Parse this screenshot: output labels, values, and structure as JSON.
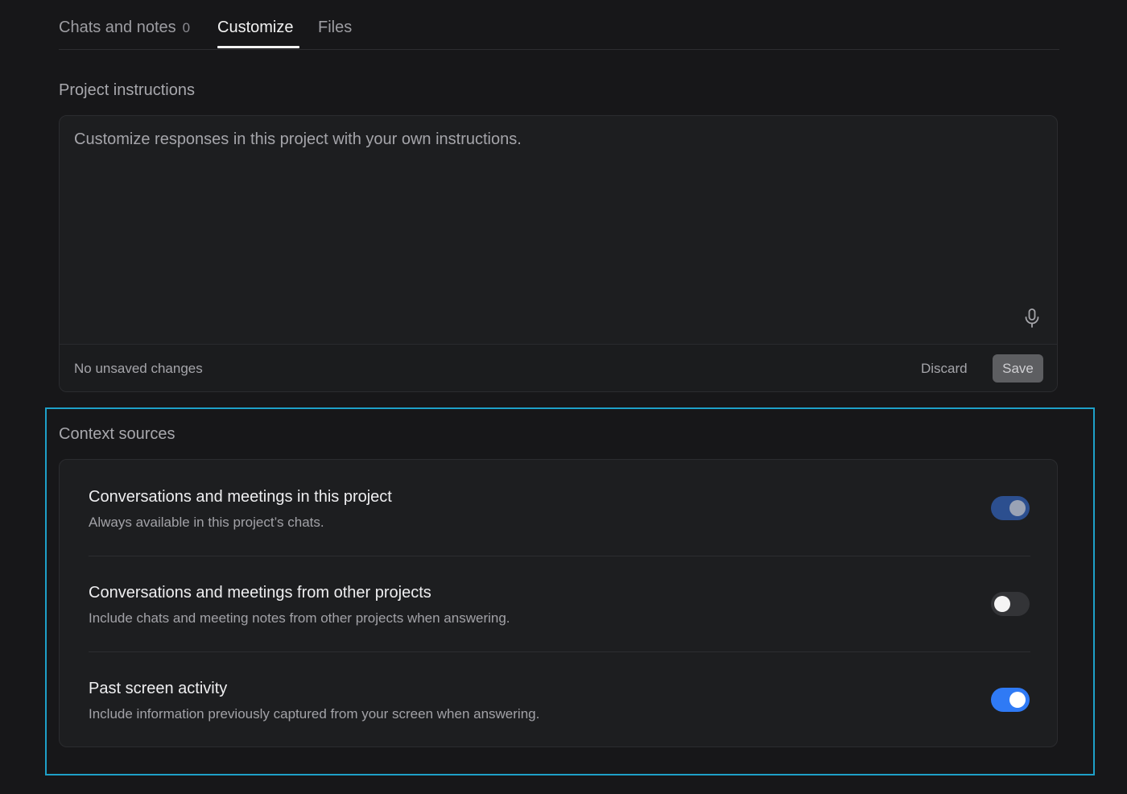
{
  "tabs": [
    {
      "label": "Chats and notes",
      "count": "0"
    },
    {
      "label": "Customize"
    },
    {
      "label": "Files"
    }
  ],
  "active_tab": "Customize",
  "instructions": {
    "title": "Project instructions",
    "placeholder": "Customize responses in this project with your own instructions.",
    "value": "",
    "status": "No unsaved changes",
    "discard_label": "Discard",
    "save_label": "Save",
    "mic_icon": "microphone-icon"
  },
  "context_sources": {
    "title": "Context sources",
    "items": [
      {
        "title": "Conversations and meetings in this project",
        "description": "Always available in this project’s chats.",
        "state": "on-locked"
      },
      {
        "title": "Conversations and meetings from other projects",
        "description": "Include chats and meeting notes from other projects when answering.",
        "state": "off"
      },
      {
        "title": "Past screen activity",
        "description": "Include information previously captured from your screen when answering.",
        "state": "on"
      }
    ]
  },
  "colors": {
    "background": "#171719",
    "card": "#1d1e20",
    "accent": "#2f7af5",
    "accent_dim": "#2c4f8f",
    "highlight": "#1ea0c8"
  }
}
